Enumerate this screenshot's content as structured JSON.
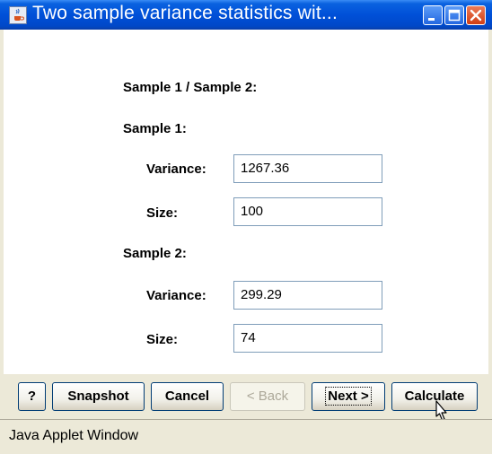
{
  "window": {
    "title": "Two sample variance statistics wit...",
    "title_icon": "java-cup-icon",
    "controls": [
      "minimize-icon",
      "maximize-icon",
      "close-icon"
    ],
    "accent": "#0050d8",
    "close_color": "#d03e14"
  },
  "form": {
    "header": "Sample 1 / Sample 2:",
    "sample1": {
      "heading": "Sample 1:",
      "variance_label": "Variance:",
      "variance_value": "1267.36",
      "size_label": "Size:",
      "size_value": "100"
    },
    "sample2": {
      "heading": "Sample 2:",
      "variance_label": "Variance:",
      "variance_value": "299.29",
      "size_label": "Size:",
      "size_value": "74"
    }
  },
  "buttons": {
    "help": "?",
    "snapshot": "Snapshot",
    "cancel": "Cancel",
    "back": "< Back",
    "next": "Next >",
    "calculate": "Calculate"
  },
  "status": {
    "text": "Java Applet Window"
  }
}
